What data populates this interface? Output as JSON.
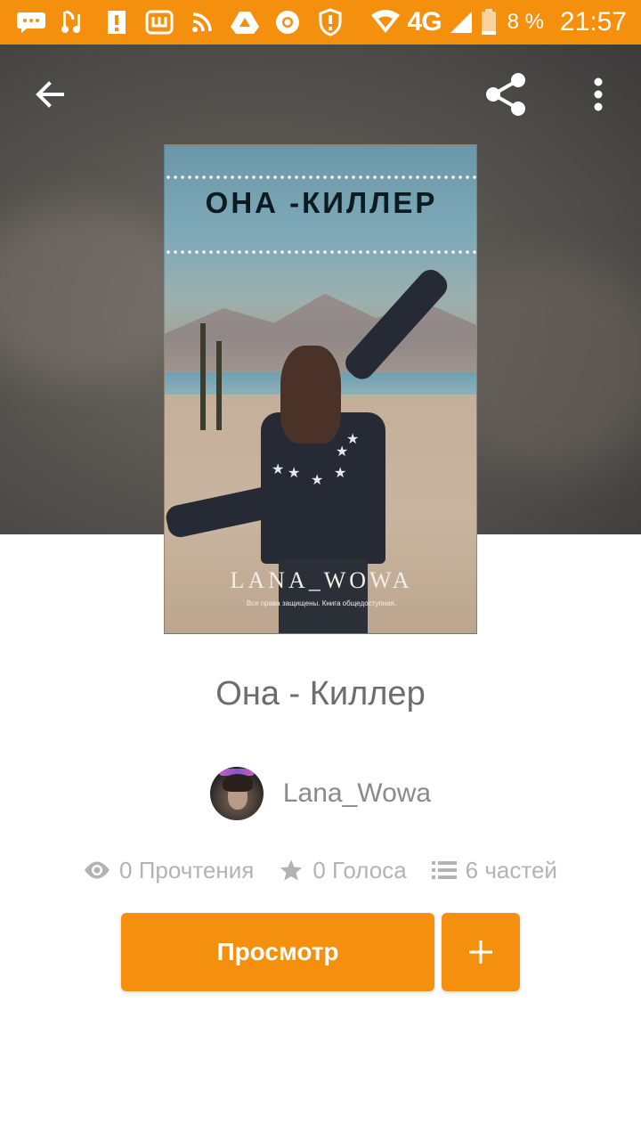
{
  "status_bar": {
    "network": "4G",
    "battery_percent": "8 %",
    "time": "21:57",
    "icons_left": [
      "message-icon",
      "music-icon",
      "alert-icon",
      "w-app-icon",
      "rss-icon",
      "drive-icon",
      "chrome-icon",
      "shield-alert-icon"
    ]
  },
  "toolbar": {
    "back_icon": "arrow-left-icon",
    "share_icon": "share-icon",
    "menu_icon": "more-vert-icon"
  },
  "cover": {
    "title": "ОНА -КИЛЛЕР",
    "author": "LANA_WOWA",
    "rights": "Все права защищены. Книга общедоступная."
  },
  "story": {
    "title": "Она - Киллер",
    "author": "Lana_Wowa",
    "reads": "0 Прочтения",
    "votes": "0 Голоса",
    "parts": "6 частей"
  },
  "actions": {
    "view_label": "Просмотр",
    "add_icon": "plus-icon"
  },
  "colors": {
    "accent": "#f5900f",
    "title_text": "#6d6d6d",
    "stats_text": "#b3b3b3"
  }
}
